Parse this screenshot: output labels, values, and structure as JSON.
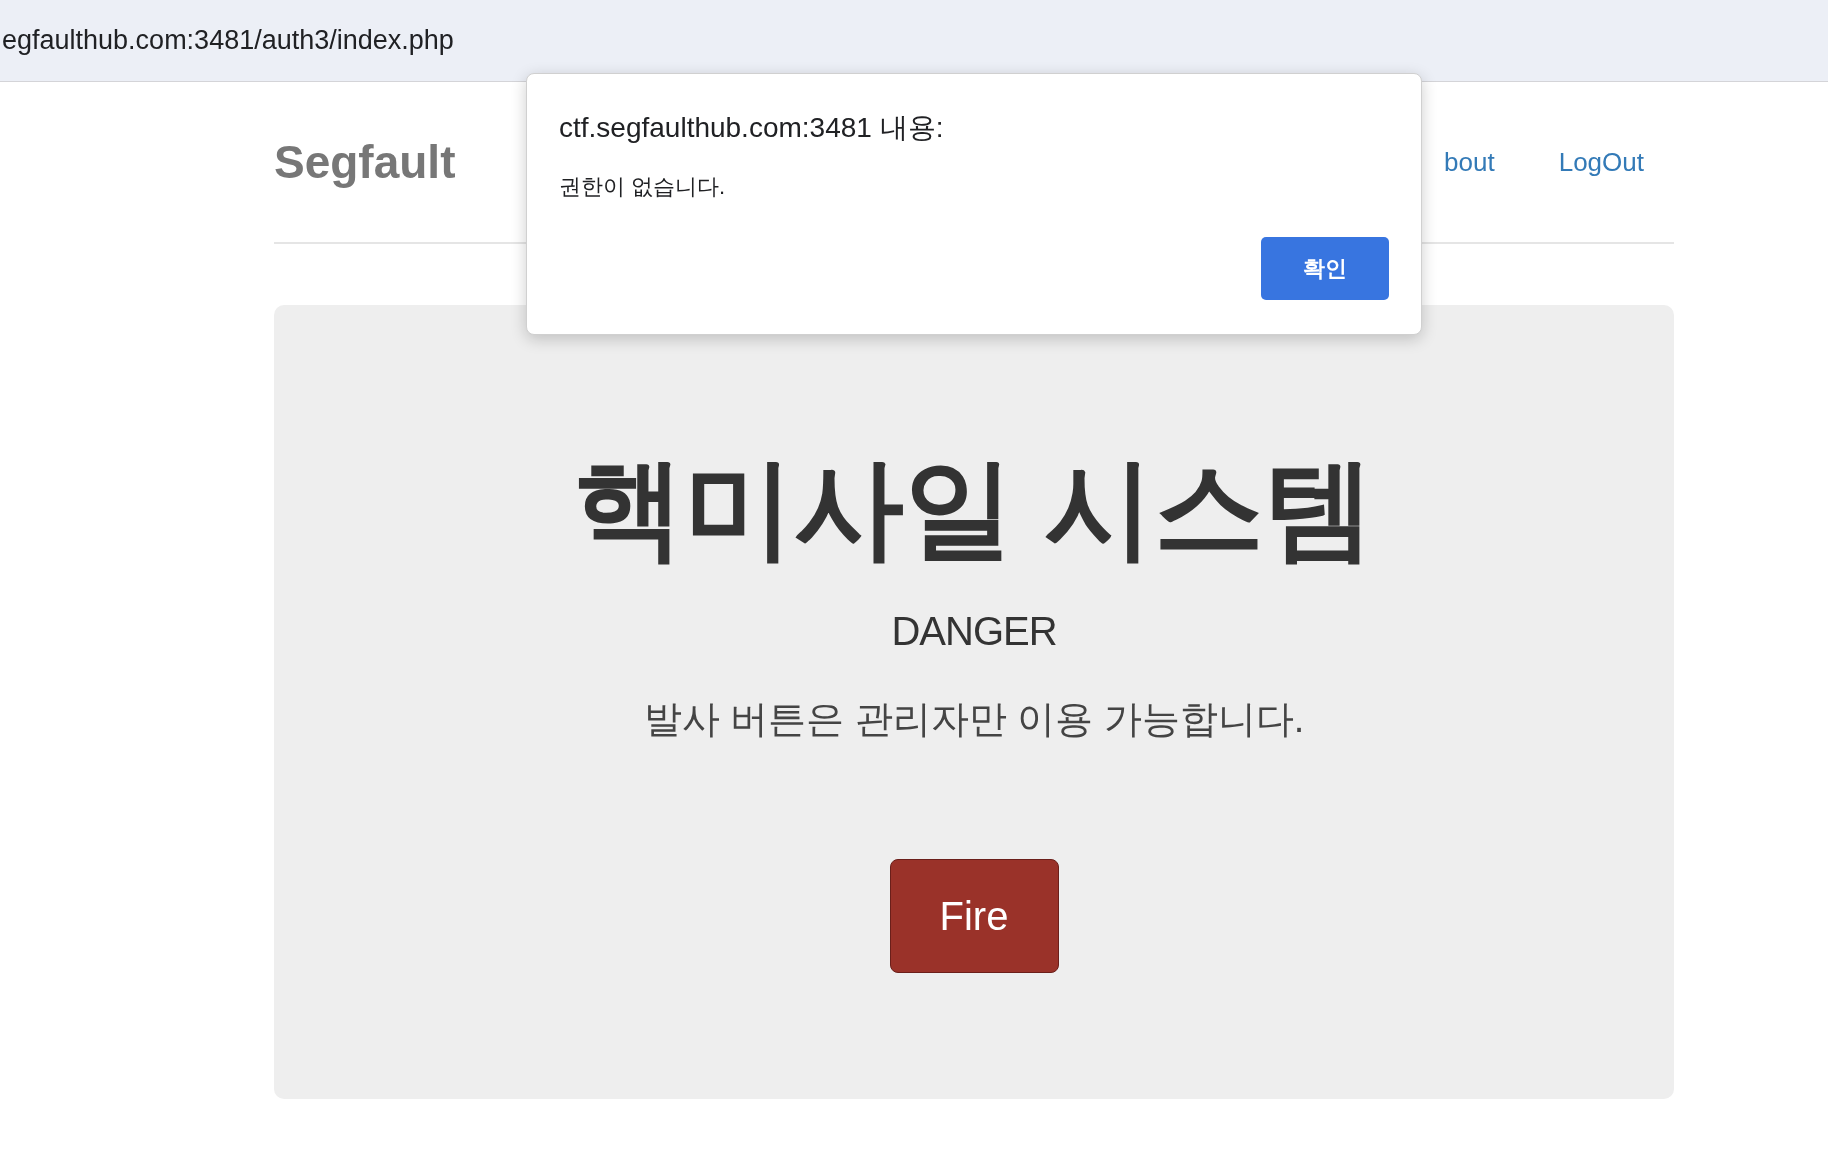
{
  "browser": {
    "address": "egfaulthub.com:3481/auth3/index.php"
  },
  "navbar": {
    "brand": "Segfault",
    "links": [
      {
        "label": "bout"
      },
      {
        "label": "LogOut"
      }
    ]
  },
  "jumbotron": {
    "title": "핵미사일 시스템",
    "subtitle": "DANGER",
    "text": "발사 버튼은 관리자만 이용 가능합니다.",
    "button": "Fire"
  },
  "alert": {
    "title": "ctf.segfaulthub.com:3481 내용:",
    "message": "권한이 없습니다.",
    "button": "확인"
  }
}
